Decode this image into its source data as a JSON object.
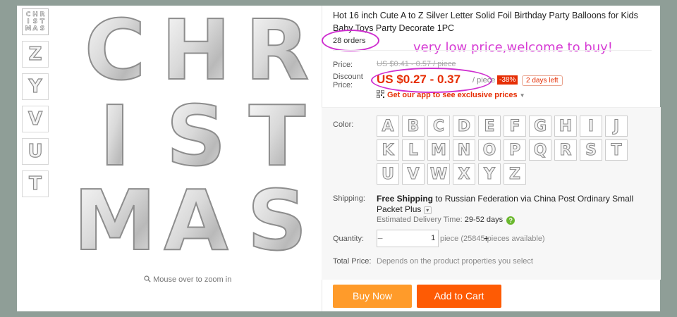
{
  "gallery": {
    "thumbnails": [
      "CHRISTMAS",
      "Z",
      "Y",
      "V",
      "U",
      "T"
    ],
    "main_image_letters": [
      "C",
      "H",
      "R",
      "I",
      "S",
      "T",
      "M",
      "A",
      "S"
    ],
    "zoom_hint": "Mouse over to zoom in"
  },
  "product": {
    "title": "Hot 16 inch Cute A to Z Silver Letter Solid Foil Birthday Party Balloons for Kids Baby Toys Party Decorate 1PC",
    "orders": "28 orders",
    "promo_note": "very low price,welcome to buy!"
  },
  "pricing": {
    "price_label": "Price:",
    "original_price": "US $0.41 - 0.57 / piece",
    "discount_label_line1": "Discount",
    "discount_label_line2": "Price:",
    "discount_price": "US $0.27 - 0.37",
    "per_piece": "/ piece",
    "discount_badge": "-38%",
    "days_left": "2 days left",
    "app_promo": "Get our app to see exclusive prices"
  },
  "options": {
    "color_label": "Color:",
    "colors": [
      "A",
      "B",
      "C",
      "D",
      "E",
      "F",
      "G",
      "H",
      "I",
      "J",
      "K",
      "L",
      "M",
      "N",
      "O",
      "P",
      "Q",
      "R",
      "S",
      "T",
      "U",
      "V",
      "W",
      "X",
      "Y",
      "Z"
    ]
  },
  "shipping": {
    "label": "Shipping:",
    "free": "Free Shipping",
    "to": "to",
    "destination": "Russian Federation via China Post Ordinary Small Packet Plus",
    "delivery_label": "Estimated Delivery Time:",
    "delivery_days": "29-52 days"
  },
  "quantity": {
    "label": "Quantity:",
    "value": "1",
    "minus": "−",
    "plus": "+",
    "stock": "piece (25845 pieces available)"
  },
  "total": {
    "label": "Total Price:",
    "value": "Depends on the product properties you select"
  },
  "actions": {
    "buy_now": "Buy Now",
    "add_to_cart": "Add to Cart"
  },
  "colors": {
    "accent_red": "#e62e04",
    "buy_orange": "#ff9b2a",
    "cart_orange": "#fe5b04",
    "annotation_magenta": "#cf2fd0",
    "frame_background": "#8f9e97"
  }
}
